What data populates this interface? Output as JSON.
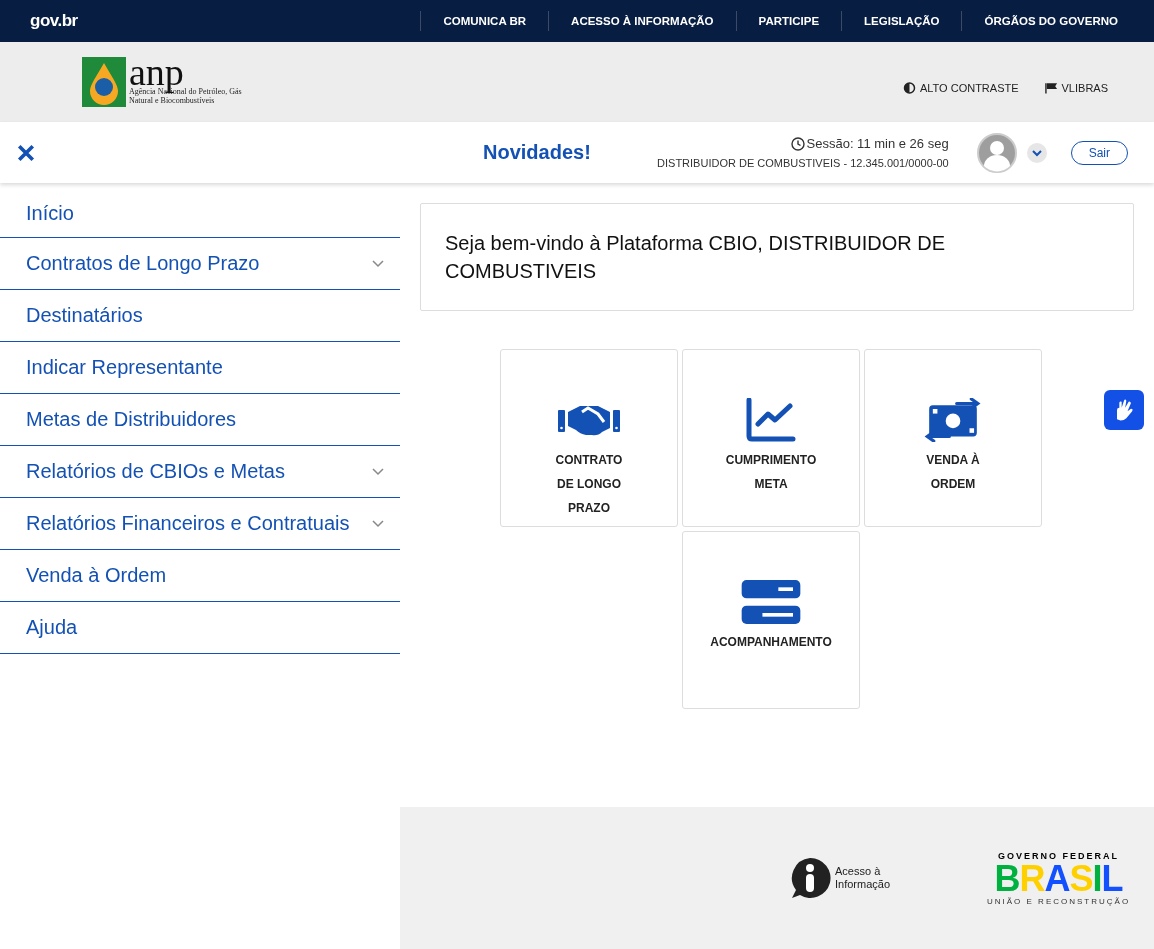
{
  "gov_bar": {
    "logo": "gov.br",
    "links": [
      "COMUNICA BR",
      "ACESSO À INFORMAÇÃO",
      "PARTICIPE",
      "LEGISLAÇÃO",
      "ÓRGÃOS DO GOVERNO"
    ]
  },
  "header": {
    "logo_text": "anp",
    "logo_tagline": "Agência Nacional do Petróleo, Gás Natural e Biocombustíveis",
    "actions": [
      {
        "kind": "contrast",
        "label": "ALTO CONTRASTE"
      },
      {
        "kind": "libras",
        "label": "VLIBRAS"
      }
    ]
  },
  "top_bar": {
    "news": "Novidades!",
    "session": "Sessão: 11 min e 26 seg",
    "company": "DISTRIBUIDOR DE COMBUSTIVEIS - 12.345.001/0000-00",
    "logout": "Sair"
  },
  "sidebar": {
    "items": [
      {
        "label": "Início",
        "expandable": false
      },
      {
        "label": "Contratos de Longo Prazo",
        "expandable": true
      },
      {
        "label": "Destinatários",
        "expandable": false
      },
      {
        "label": "Indicar Representante",
        "expandable": false
      },
      {
        "label": "Metas de Distribuidores",
        "expandable": false
      },
      {
        "label": "Relatórios de CBIOs e Metas",
        "expandable": true
      },
      {
        "label": "Relatórios Financeiros e Contratuais",
        "expandable": true
      },
      {
        "label": "Venda à Ordem",
        "expandable": false
      },
      {
        "label": "Ajuda",
        "expandable": false
      }
    ]
  },
  "welcome": "Seja bem-vindo à Plataforma CBIO, DISTRIBUIDOR DE COMBUSTIVEIS",
  "tiles": [
    {
      "kind": "handshake",
      "lines": [
        "CONTRATO",
        "DE LONGO",
        "PRAZO"
      ]
    },
    {
      "kind": "chart",
      "lines": [
        "CUMPRIMENTO",
        "META"
      ]
    },
    {
      "kind": "money",
      "lines": [
        "VENDA À",
        "ORDEM"
      ]
    },
    {
      "kind": "list",
      "lines": [
        "ACOMPANHAMENTO"
      ]
    }
  ],
  "footer": {
    "info_link": "Acesso à Informação",
    "gov_title": "GOVERNO FEDERAL",
    "gov_word": "BRASIL",
    "gov_motto": "UNIÃO E RECONSTRUÇÃO"
  }
}
